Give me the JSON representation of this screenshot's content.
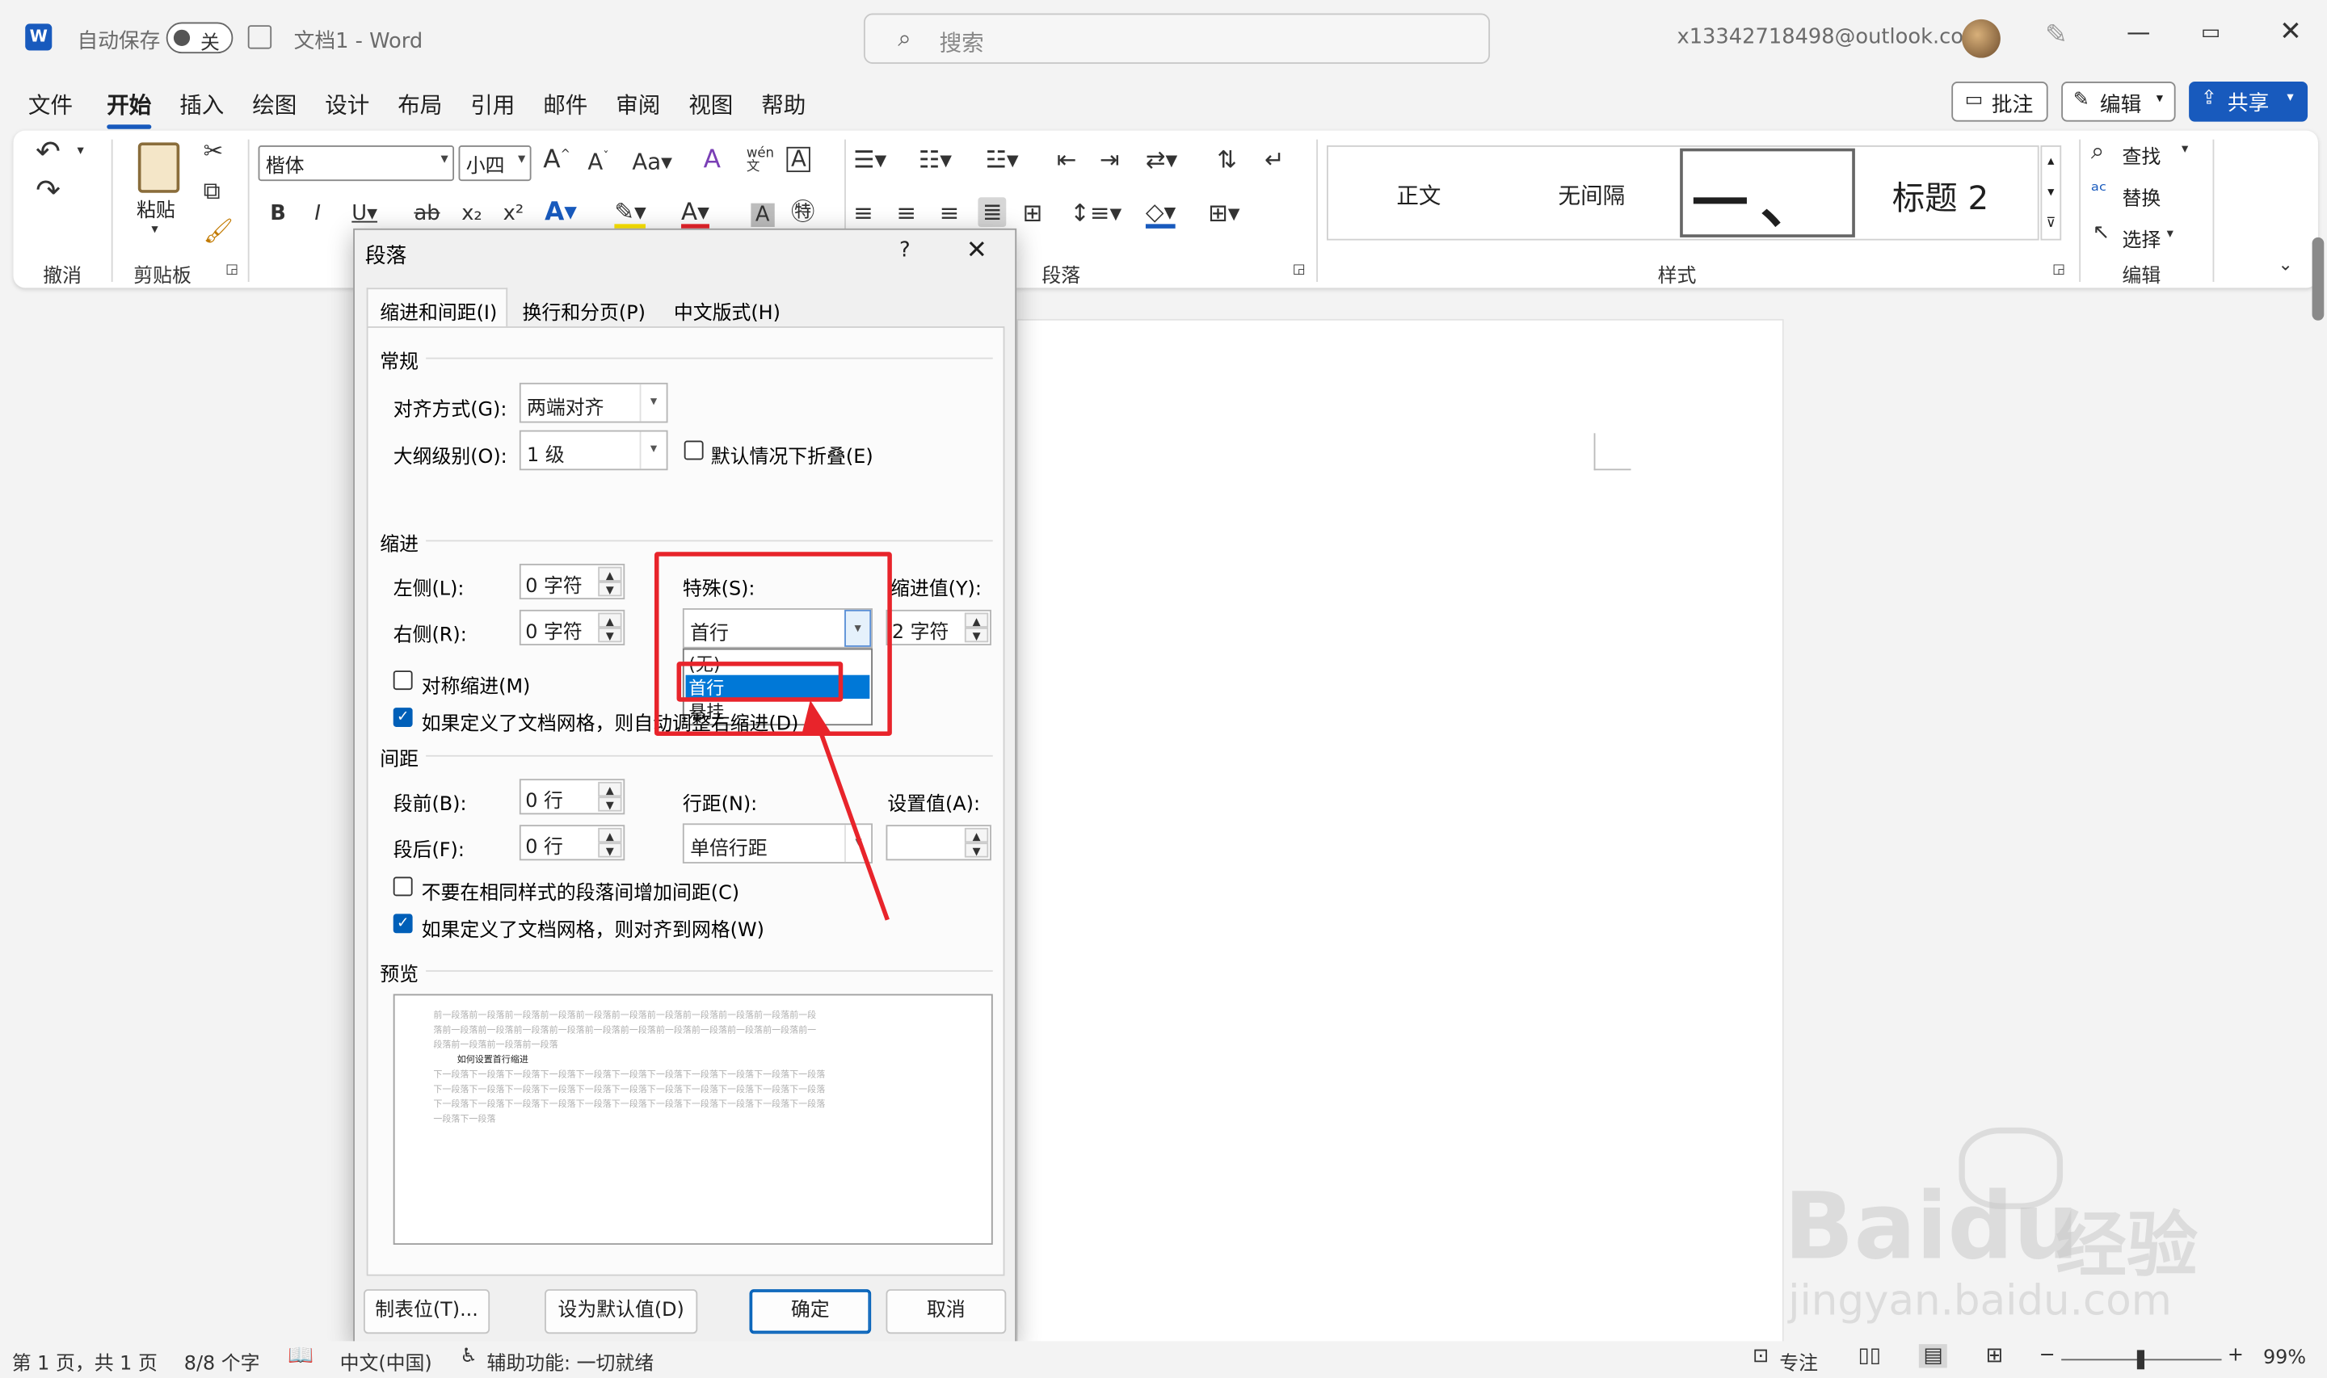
{
  "titlebar": {
    "autosave": "自动保存",
    "toggle": "关",
    "docname": "文档1 - Word",
    "search_placeholder": "搜索",
    "account": "x13342718498@outlook.com"
  },
  "tabs": [
    "文件",
    "开始",
    "插入",
    "绘图",
    "设计",
    "布局",
    "引用",
    "邮件",
    "审阅",
    "视图",
    "帮助"
  ],
  "actions": {
    "comment": "批注",
    "edit": "编辑",
    "share": "共享"
  },
  "ribbon": {
    "groups": {
      "undo": "撤消",
      "clipboard": "剪贴板",
      "paragraph": "段落",
      "styles": "样式",
      "editing": "编辑"
    },
    "paste": "粘贴",
    "font_name": "楷体",
    "font_size": "小四",
    "styles": [
      "正文",
      "无间隔",
      "一、",
      "标题 2"
    ],
    "find": "查找",
    "replace": "替换",
    "select": "选择"
  },
  "dialog": {
    "title": "段落",
    "help": "?",
    "tabs": [
      "缩进和间距(I)",
      "换行和分页(P)",
      "中文版式(H)"
    ],
    "general": "常规",
    "alignment_label": "对齐方式(G):",
    "alignment_value": "两端对齐",
    "outline_label": "大纲级别(O):",
    "outline_value": "1 级",
    "collapse_label": "默认情况下折叠(E)",
    "indent": "缩进",
    "left_label": "左侧(L):",
    "left_value": "0 字符",
    "right_label": "右侧(R):",
    "right_value": "0 字符",
    "special_label": "特殊(S):",
    "special_value": "首行",
    "indent_by_label": "缩进值(Y):",
    "indent_by_value": "2 字符",
    "special_options": [
      "(无)",
      "首行",
      "悬挂"
    ],
    "mirror_label": "对称缩进(M)",
    "auto_adjust_label": "如果定义了文档网格，则自动调整右缩进(D)",
    "spacing": "间距",
    "before_label": "段前(B):",
    "before_value": "0 行",
    "after_label": "段后(F):",
    "after_value": "0 行",
    "line_spacing_label": "行距(N):",
    "line_spacing_value": "单倍行距",
    "at_label": "设置值(A):",
    "at_value": "",
    "no_space_label": "不要在相同样式的段落间增加间距(C)",
    "snap_grid_label": "如果定义了文档网格，则对齐到网格(W)",
    "preview": "预览",
    "preview_text": [
      "前一段落前一段落前一段落前一段落前一段落前一段落前一段落前一段落前一段落前一段落前一段",
      "落前一段落前一段落前一段落前一段落前一段落前一段落前一段落前一段落前一段落前一段落前一",
      "段落前一段落前一段落前一段落",
      "如何设置首行缩进",
      "下一段落下一段落下一段落下一段落下一段落下一段落下一段落下一段落下一段落下一段落下一段落",
      "下一段落下一段落下一段落下一段落下一段落下一段落下一段落下一段落下一段落下一段落下一段落",
      "下一段落下一段落下一段落下一段落下一段落下一段落下一段落下一段落下一段落下一段落下一段落",
      "一段落下一段落"
    ],
    "tabs_btn": "制表位(T)...",
    "default_btn": "设为默认值(D)",
    "ok_btn": "确定",
    "cancel_btn": "取消"
  },
  "status": {
    "page": "第 1 页，共 1 页",
    "words": "8/8 个字",
    "lang": "中文(中国)",
    "accessibility": "辅助功能: 一切就绪",
    "focus": "专注",
    "zoom": "99%"
  },
  "watermark": {
    "brand": "Baidu",
    "brand_cn": "经验",
    "url": "jingyan.baidu.com"
  }
}
